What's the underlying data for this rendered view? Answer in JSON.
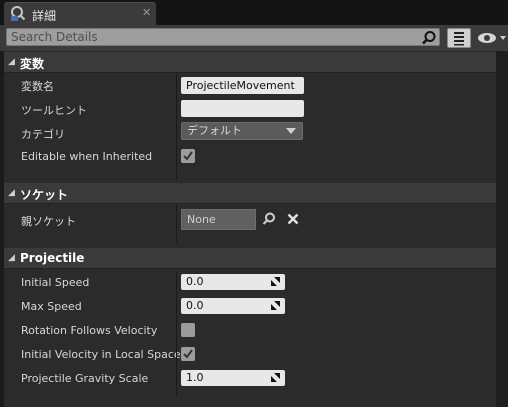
{
  "tab": {
    "label": "詳細",
    "close": "✕"
  },
  "search": {
    "placeholder": "Search Details"
  },
  "categories": [
    {
      "label": "変数",
      "rows": [
        {
          "name": "変数名",
          "value": "ProjectileMovement"
        },
        {
          "name": "ツールヒント",
          "value": ""
        },
        {
          "name": "カテゴリ",
          "value": "デフォルト"
        },
        {
          "name": "Editable when Inherited",
          "checked": true
        }
      ]
    },
    {
      "label": "ソケット",
      "rows": [
        {
          "name": "親ソケット",
          "value": "None"
        }
      ]
    },
    {
      "label": "Projectile",
      "rows": [
        {
          "name": "Initial Speed",
          "value": "0.0"
        },
        {
          "name": "Max Speed",
          "value": "0.0"
        },
        {
          "name": "Rotation Follows Velocity",
          "checked": false
        },
        {
          "name": "Initial Velocity in Local Space",
          "checked": true
        },
        {
          "name": "Projectile Gravity Scale",
          "value": "1.0"
        }
      ]
    }
  ],
  "icons": {
    "tab": "details-info-icon",
    "search": "search-icon",
    "view": "view-options-icon",
    "visibility": "eye-icon",
    "socket_browse": "search-icon",
    "socket_clear": "clear-icon"
  }
}
